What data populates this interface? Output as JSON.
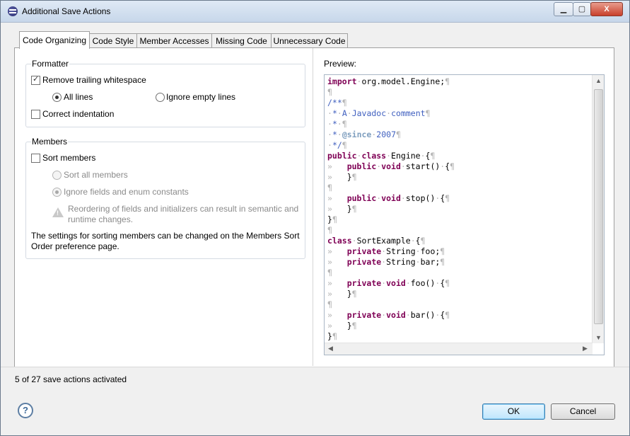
{
  "window": {
    "title": "Additional Save Actions",
    "min": "▁",
    "max": "▢",
    "close": "X"
  },
  "tabs": [
    "Code Organizing",
    "Code Style",
    "Member Accesses",
    "Missing Code",
    "Unnecessary Code"
  ],
  "formatter": {
    "legend": "Formatter",
    "remove_trailing": "Remove trailing whitespace",
    "all_lines": "All lines",
    "ignore_empty": "Ignore empty lines",
    "correct_indentation": "Correct indentation"
  },
  "members": {
    "legend": "Members",
    "sort_members": "Sort members",
    "sort_all": "Sort all members",
    "ignore_fields": "Ignore fields and enum constants",
    "warning_line1": "Reordering of fields and initializers can result in semantic and",
    "warning_line2": "runtime changes.",
    "info_line1": "The settings for sorting members can be changed on the Members Sort",
    "info_line2": "Order preference page."
  },
  "preview": {
    "label": "Preview:"
  },
  "status": "5 of 27 save actions activated",
  "buttons": {
    "ok": "OK",
    "cancel": "Cancel",
    "help": "?"
  },
  "icons": {
    "app": "eclipse-icon",
    "warning": "warning-icon",
    "help": "help-icon"
  }
}
